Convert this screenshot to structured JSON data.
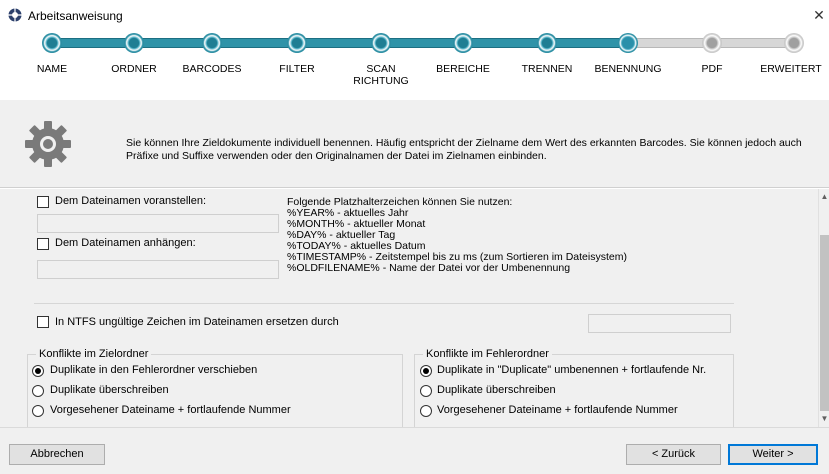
{
  "window": {
    "title": "Arbeitsanweisung",
    "close": "✕"
  },
  "steps": [
    {
      "label": "NAME",
      "state": "done"
    },
    {
      "label": "ORDNER",
      "state": "done"
    },
    {
      "label": "BARCODES",
      "state": "done"
    },
    {
      "label": "FILTER",
      "state": "done"
    },
    {
      "label": "SCAN\nRICHTUNG",
      "state": "done"
    },
    {
      "label": "BEREICHE",
      "state": "done"
    },
    {
      "label": "TRENNEN",
      "state": "done"
    },
    {
      "label": "BENENNUNG",
      "state": "current"
    },
    {
      "label": "PDF",
      "state": "todo"
    },
    {
      "label": "ERWEITERT",
      "state": "todo"
    }
  ],
  "info": {
    "icon": "gear-icon",
    "text": "Sie können Ihre Zieldokumente individuell benennen. Häufig entspricht der Zielname dem Wert des erkannten Barcodes. Sie können jedoch auch Präfixe und Suffixe verwenden oder den Originalnamen der Datei im Zielnamen einbinden."
  },
  "options": {
    "prefix_label": "Dem Dateinamen voranstellen:",
    "prefix_value": "",
    "suffix_label": "Dem Dateinamen anhängen:",
    "suffix_value": "",
    "placeholders_title": "Folgende Platzhalterzeichen können Sie nutzen:",
    "placeholders": [
      "%YEAR% - aktuelles Jahr",
      "%MONTH% - aktueller Monat",
      "%DAY% - aktueller Tag",
      "%TODAY% - aktuelles Datum",
      "%TIMESTAMP% - Zeitstempel bis zu ms (zum Sortieren im Dateisystem)",
      "%OLDFILENAME% - Name der Datei vor der Umbenennung"
    ],
    "ntfs_label": "In NTFS ungültige Zeichen im Dateinamen ersetzen durch",
    "ntfs_value": ""
  },
  "conflicts_target": {
    "title": "Konflikte im Zielordner",
    "options": [
      {
        "label": "Duplikate in den Fehlerordner verschieben",
        "selected": true
      },
      {
        "label": "Duplikate überschreiben",
        "selected": false
      },
      {
        "label": "Vorgesehener Dateiname + fortlaufende Nummer",
        "selected": false
      }
    ]
  },
  "conflicts_error": {
    "title": "Konflikte im Fehlerordner",
    "options": [
      {
        "label": "Duplikate in \"Duplicate\" umbenennen + fortlaufende Nr.",
        "selected": true
      },
      {
        "label": "Duplikate überschreiben",
        "selected": false
      },
      {
        "label": "Vorgesehener Dateiname + fortlaufende Nummer",
        "selected": false
      }
    ]
  },
  "scrollbar": {
    "up": "▲",
    "down": "▼"
  },
  "footer": {
    "cancel": "Abbrechen",
    "back": "< Zurück",
    "next": "Weiter >"
  },
  "colors": {
    "accent": "#2f93a8",
    "inactive": "#bdbdbd",
    "panel": "#f0f0f0"
  }
}
